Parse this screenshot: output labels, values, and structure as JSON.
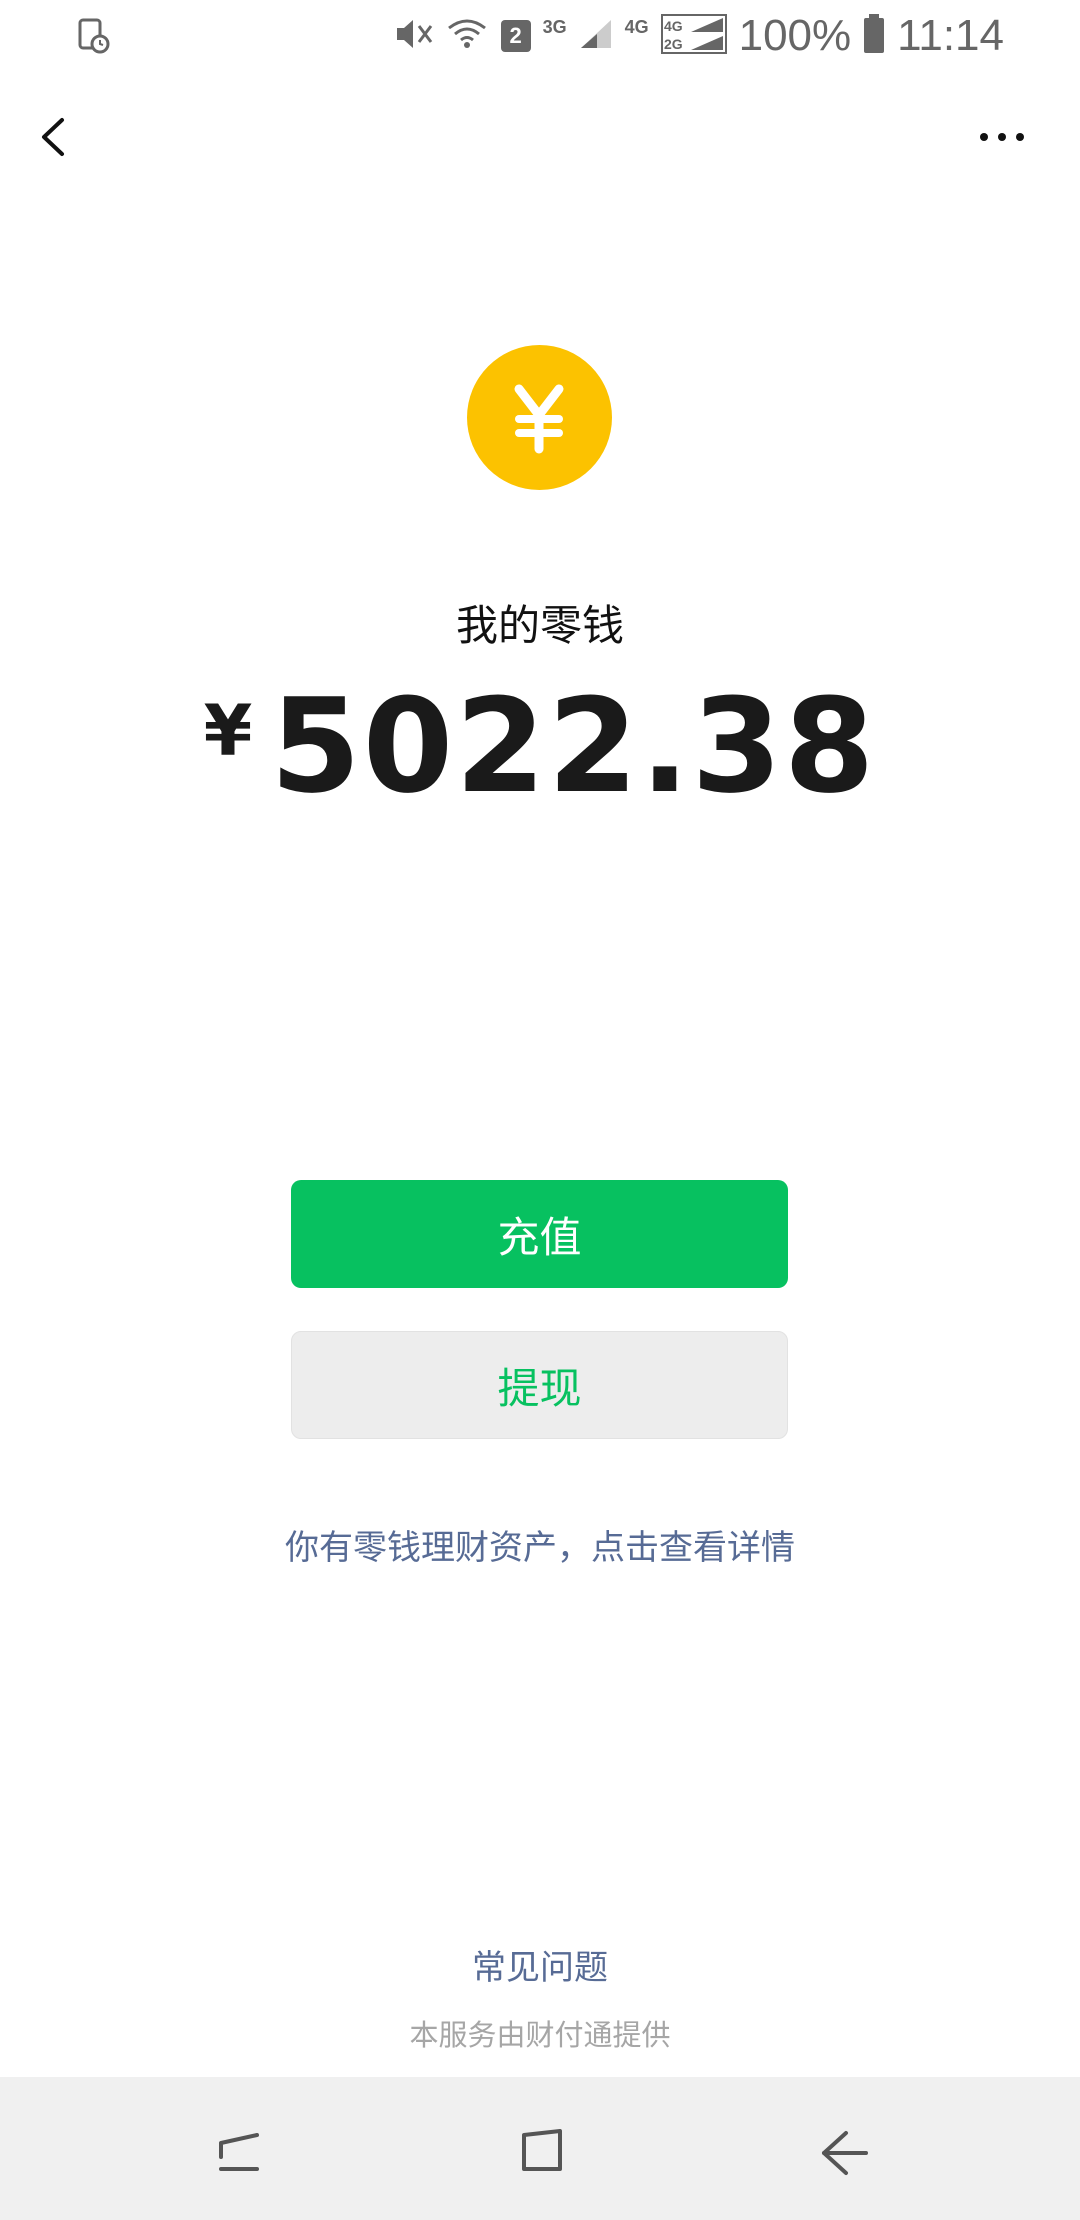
{
  "status_bar": {
    "battery_percent": "100%",
    "time": "11:14",
    "sim_slot": "2",
    "net_3g": "3G",
    "net_4g": "4G",
    "net_4g_small": "4G",
    "net_2g_small": "2G"
  },
  "header": {
    "back_icon": "chevron-left-icon",
    "more_icon": "more-dots-icon"
  },
  "wallet": {
    "icon": "yuan-coin-icon",
    "coin_color": "#fcc200",
    "title": "我的零钱",
    "currency_symbol": "¥",
    "balance": "5022.38"
  },
  "actions": {
    "top_up_label": "充值",
    "withdraw_label": "提现",
    "accent_color": "#07c160"
  },
  "links": {
    "finance_assets": "你有零钱理财资产，点击查看详情",
    "faq": "常见问题",
    "provider_note": "本服务由财付通提供"
  },
  "system_nav": {
    "recent_icon": "recent-apps-icon",
    "home_icon": "home-icon",
    "back_icon": "back-arrow-icon"
  }
}
